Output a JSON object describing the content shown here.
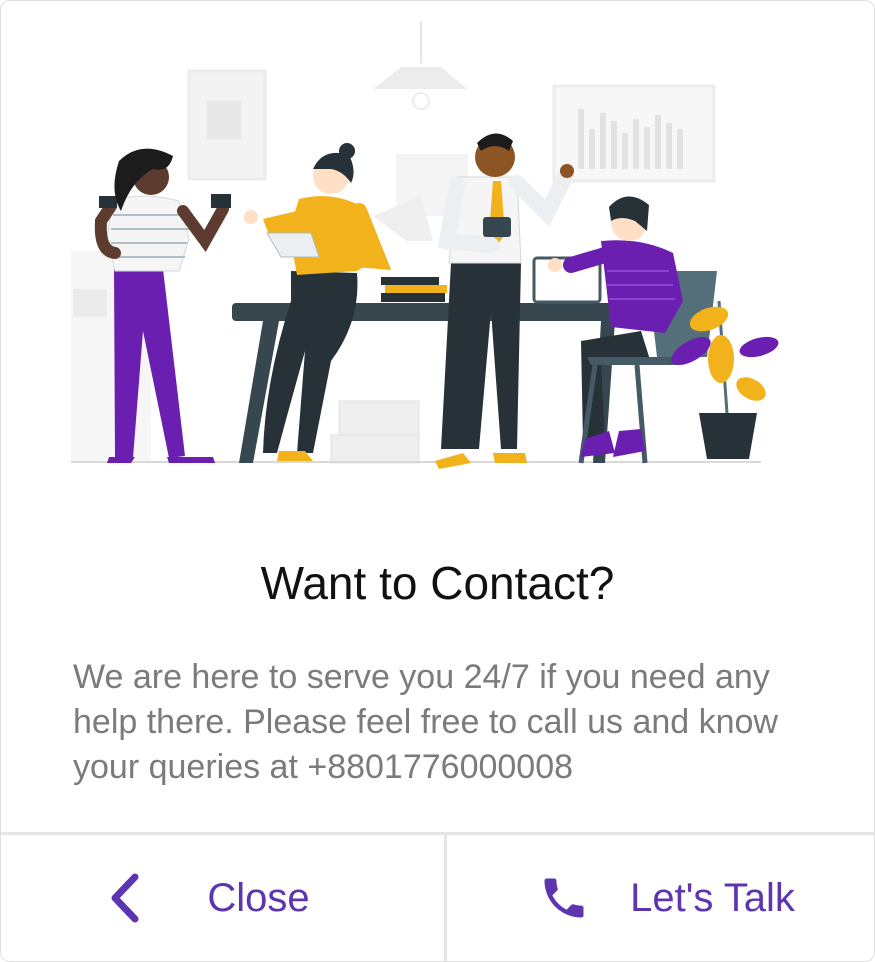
{
  "dialog": {
    "title": "Want to Contact?",
    "message": "We are here to serve you 24/7 if you need any help there. Please feel free to call us and know your queries at +8801776000008",
    "close_label": "Close",
    "talk_label": "Let's Talk"
  },
  "icons": {
    "close": "chevron-left-icon",
    "talk": "phone-icon"
  },
  "colors": {
    "accent": "#5e35b1",
    "purple": "#6a1fb0",
    "yellow": "#f2b21b",
    "dark": "#263238"
  }
}
